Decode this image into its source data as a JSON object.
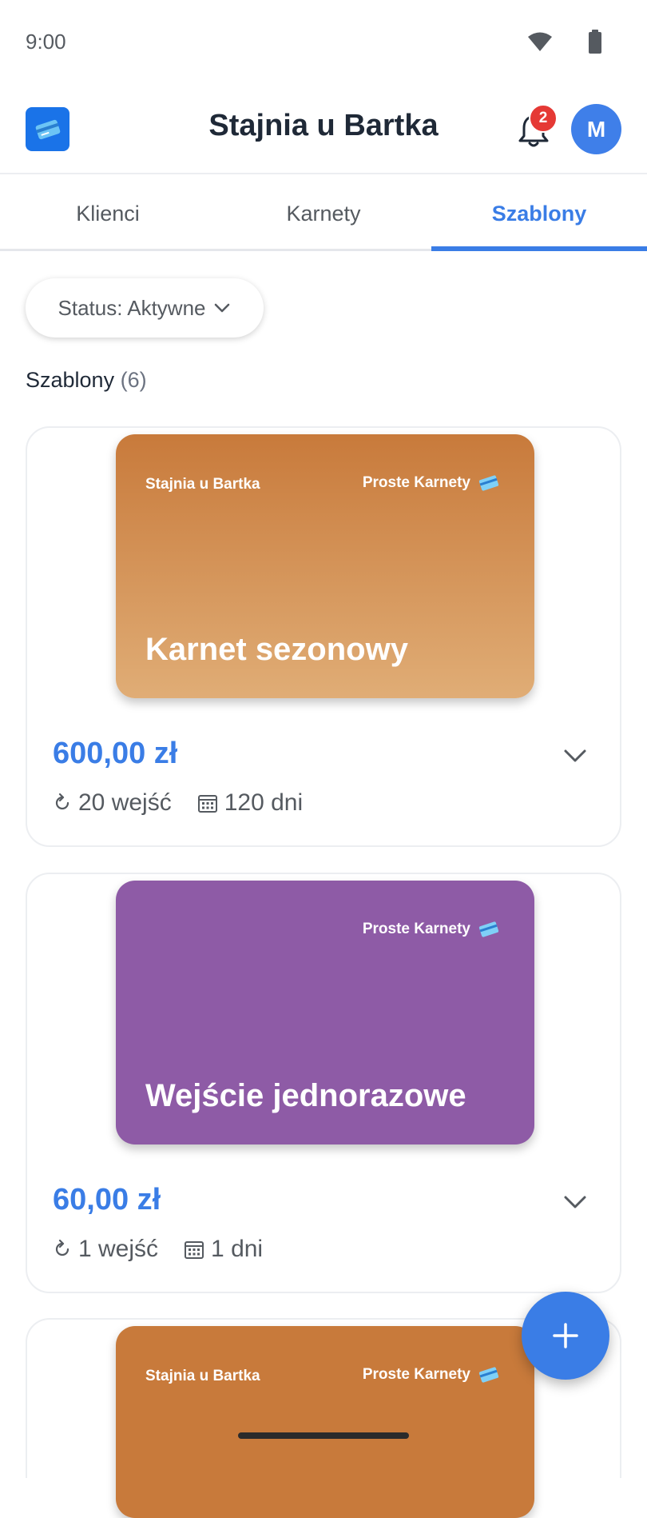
{
  "status_bar": {
    "time": "9:00"
  },
  "header": {
    "title": "Stajnia u Bartka",
    "notification_count": "2",
    "avatar_initial": "M",
    "colors": {
      "logo": "#1a73e8",
      "avatar": "#3f7fe9",
      "badge": "#e53935"
    }
  },
  "tabs": [
    {
      "label": "Klienci",
      "active": false
    },
    {
      "label": "Karnety",
      "active": false
    },
    {
      "label": "Szablony",
      "active": true
    }
  ],
  "filter": {
    "label": "Status: Aktywne"
  },
  "section": {
    "title": "Szablony",
    "count": "(6)"
  },
  "templates": [
    {
      "brand": "Stajnia u Bartka",
      "provider": "Proste Karnety",
      "name": "Karnet sezonowy",
      "price": "600,00 zł",
      "entries": "20 wejść",
      "duration": "120 dni",
      "color_top": "#c87a3b",
      "color_bottom": "#e0ad76"
    },
    {
      "brand": "",
      "provider": "Proste Karnety",
      "name": "Wejście jednorazowe",
      "price": "60,00 zł",
      "entries": "1 wejść",
      "duration": "1 dni",
      "color_top": "#8e5ba6",
      "color_bottom": "#8e5ba6"
    },
    {
      "brand": "Stajnia u Bartka",
      "provider": "Proste Karnety",
      "name": "",
      "price": "",
      "entries": "",
      "duration": "",
      "color_top": "#c87a3b",
      "color_bottom": "#c87a3b"
    }
  ],
  "accent_color": "#3a7de6"
}
